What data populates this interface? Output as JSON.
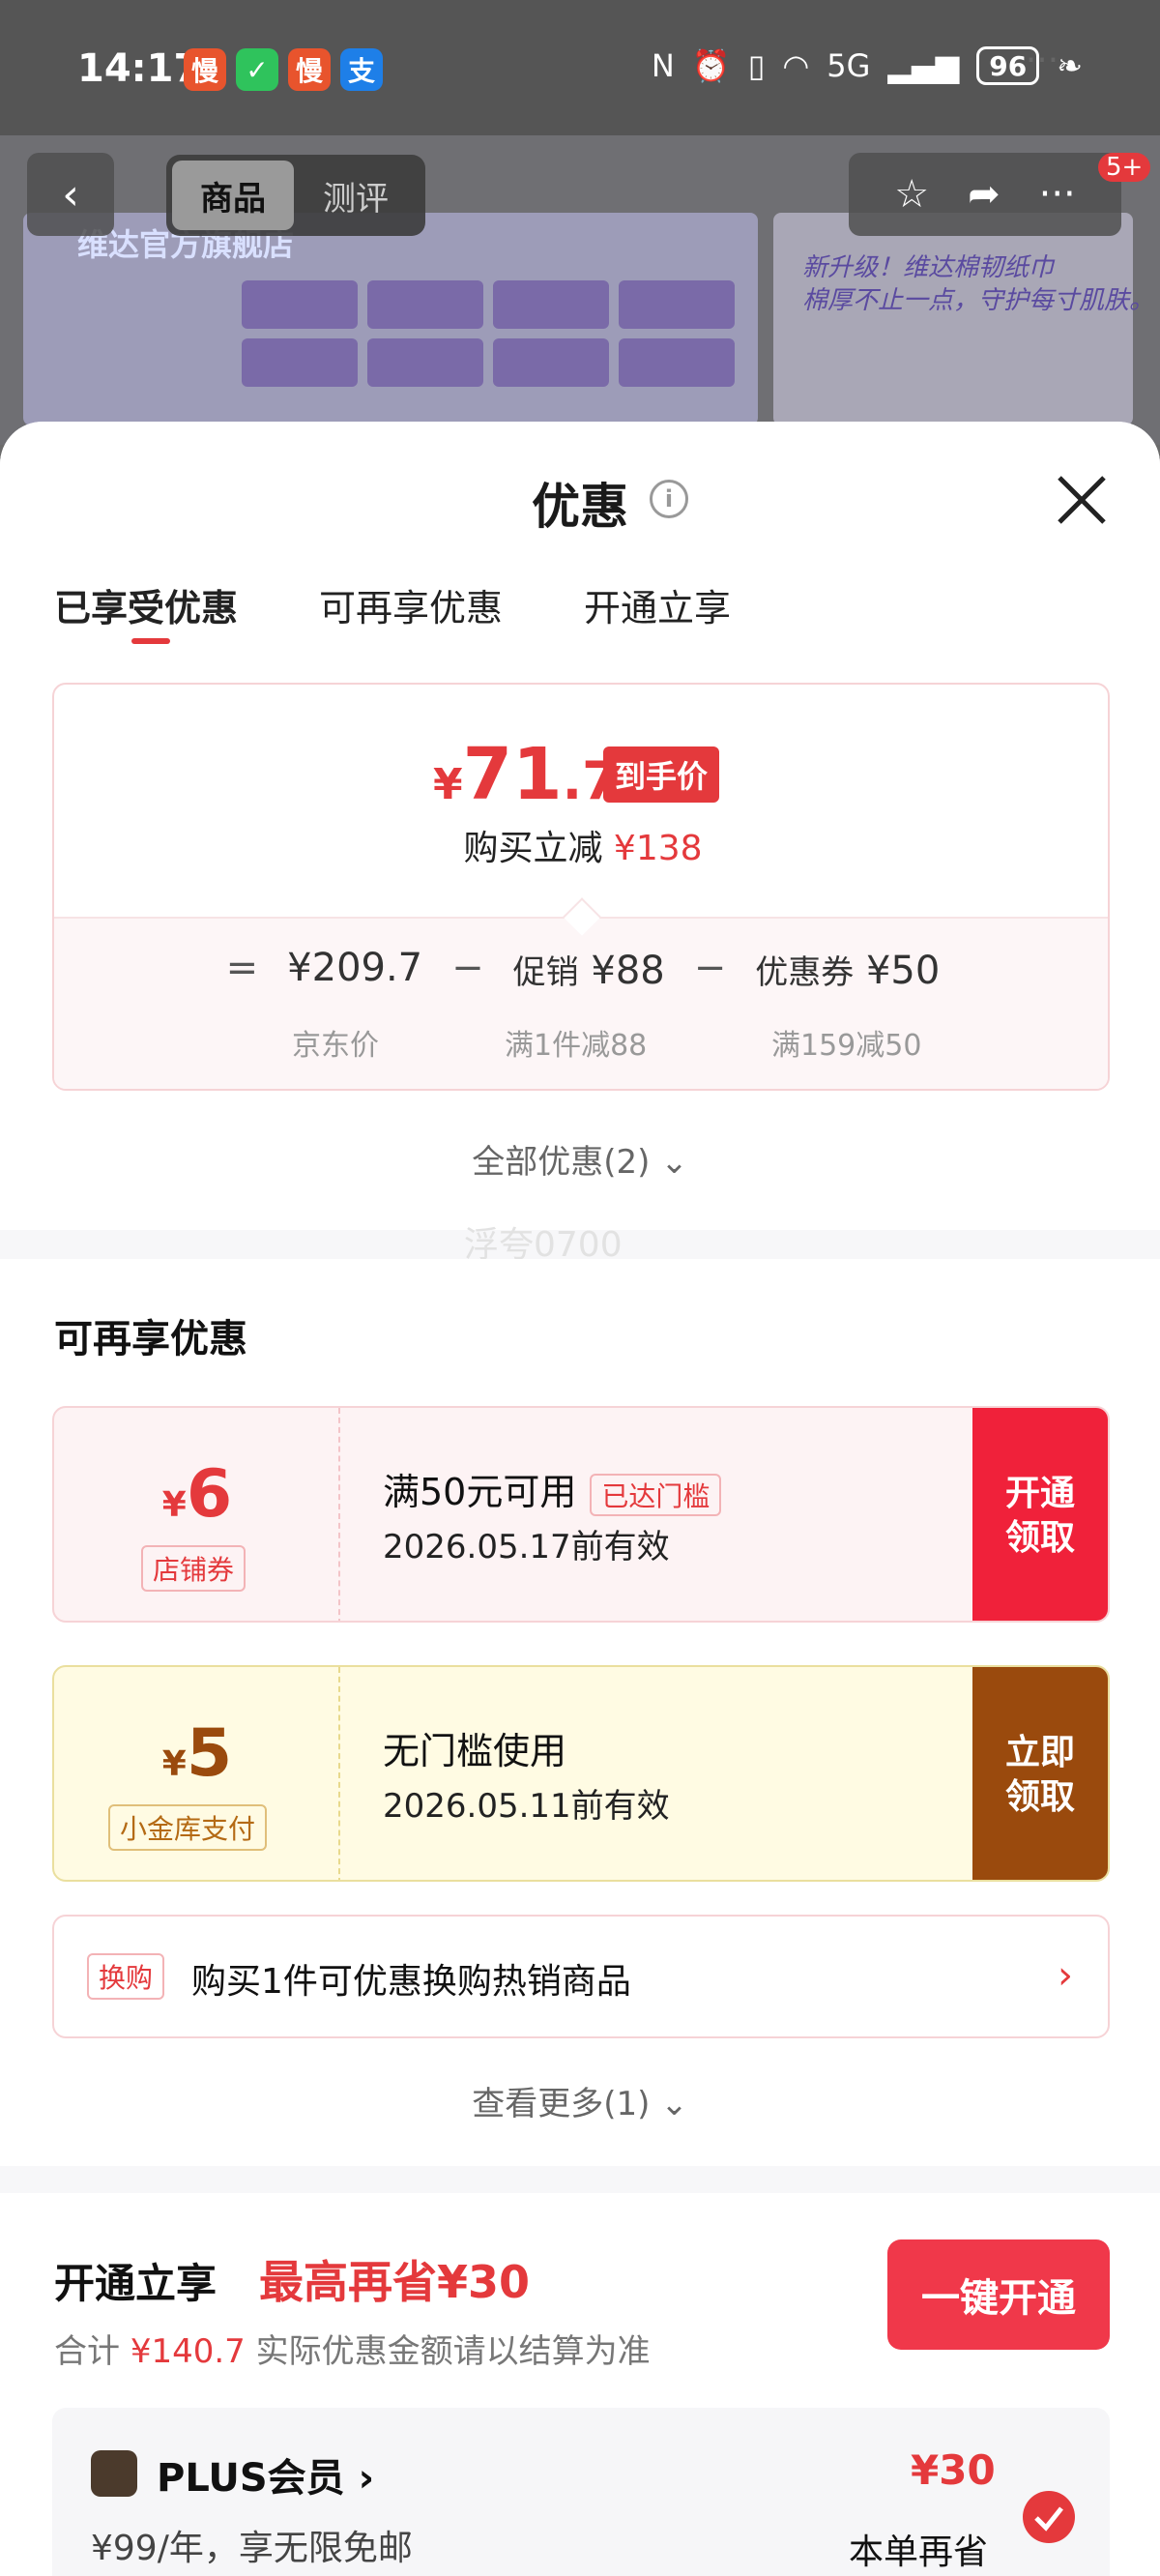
{
  "status": {
    "time": "14:17",
    "apps": [
      {
        "name": "slow-app-icon",
        "label": "慢",
        "color": "#e8542d"
      },
      {
        "name": "wechat-icon",
        "label": "✓",
        "color": "#2fc35c"
      },
      {
        "name": "slow-app-icon-2",
        "label": "慢",
        "color": "#e8542d"
      },
      {
        "name": "alipay-icon",
        "label": "支",
        "color": "#1e7fe8"
      }
    ],
    "more": "···",
    "network": "5G",
    "battery": "96"
  },
  "backdrop": {
    "tab_goods": "商品",
    "tab_review": "测评",
    "brand": "维达官方旗舰店",
    "promo": "新升级！维达棉韧纸巾\n棉厚不止一点，守护每寸肌肤。",
    "badge": "5+"
  },
  "sheet": {
    "title": "优惠",
    "tabs": [
      "已享受优惠",
      "可再享优惠",
      "开通立享"
    ],
    "price_card": {
      "currency": "¥",
      "int": "71",
      "dec": ".7",
      "tag": "到手价",
      "reduce_label": "购买立减",
      "reduce_value": "¥138",
      "formula": {
        "eq": "=",
        "jd_price": "¥209.7",
        "minus": "−",
        "promo_label": "促销",
        "promo_value": "¥88",
        "coupon_label": "优惠券",
        "coupon_value": "¥50"
      },
      "sub": {
        "jd": "京东价",
        "promo": "满1件减88",
        "coupon": "满159减50"
      }
    },
    "all_offers": "全部优惠(2) ⌄",
    "watermark": "浮夸0700"
  },
  "more_offers": {
    "title": "可再享优惠",
    "coupons": [
      {
        "currency": "¥",
        "value": "6",
        "kind": "店铺券",
        "condition": "满50元可用",
        "reached": "已达门槛",
        "expiry": "2026.05.17前有效",
        "action": "开通\n领取",
        "accent": "#f0213a",
        "bg": "#fdf3f4",
        "kind_color": "#e4393c"
      },
      {
        "currency": "¥",
        "value": "5",
        "kind": "小金库支付",
        "condition": "无门槛使用",
        "reached": "",
        "expiry": "2026.05.11前有效",
        "action": "立即\n领取",
        "accent": "#9a4a0d",
        "bg": "#fffbe3",
        "kind_color": "#b46a14"
      }
    ],
    "swap": {
      "tag": "换购",
      "text": "购买1件可优惠换购热销商品",
      "chevron": "›"
    },
    "see_more": "查看更多(1) ⌄"
  },
  "open_now": {
    "title": "开通立享",
    "max_save": "最高再省¥30",
    "sum_prefix": "合计",
    "sum_value": "¥140.7",
    "sum_suffix": "实际优惠金额请以结算为准",
    "button": "一键开通",
    "plus": {
      "name": "PLUS会员 ›",
      "desc": "¥99/年，享无限免邮",
      "amount": "¥30",
      "save_label": "本单再省"
    }
  }
}
